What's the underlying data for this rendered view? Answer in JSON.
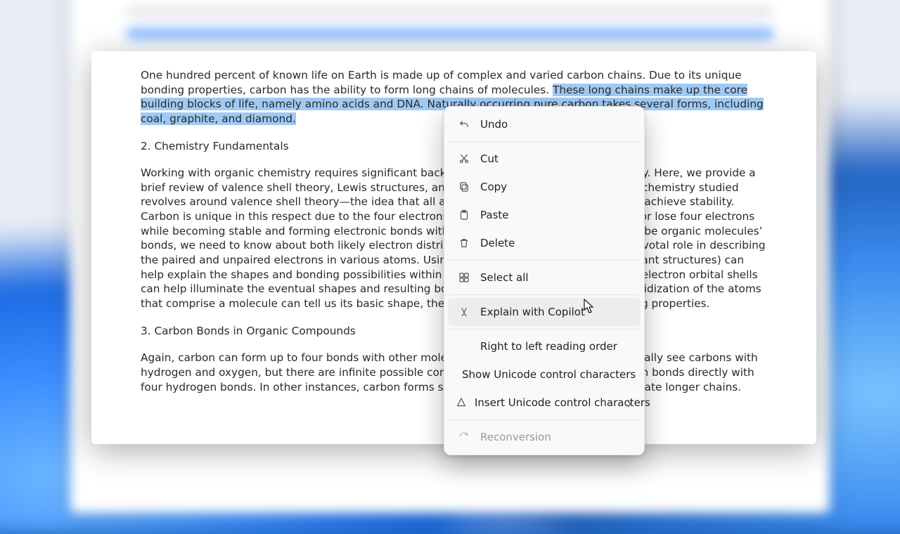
{
  "document": {
    "para1": {
      "before": "One hundred percent of known life on Earth is made up of complex and varied carbon chains. Due to its unique bonding properties, carbon has the ability to form long chains of molecules. ",
      "selected": "These long chains make up the core building blocks of life, namely amino acids and DNA. Naturally occurring pure carbon takes several forms, including coal, graphite, and diamond."
    },
    "heading2": "2. Chemistry Fundamentals",
    "para2": "Working with organic chemistry requires significant background in classic analytical chemistry. Here, we provide a brief review of valence shell theory, Lewis structures, and molecular geometry. Most organic chemistry studied revolves around valence shell theory—the idea that all atoms either gain or lose electrons to achieve stability. Carbon is unique in this respect due to the four electrons in its outer shell. It can either gain or lose four electrons while becoming stable and forming electronic bonds with other atoms or molecules. To describe organic molecules’ bonds, we need to know about both likely electron distribution. Lewis dot structures play a pivotal role in describing the paired and unpaired electrons in various atoms. Using these structures (examining resonant structures) can help explain the shapes and bonding possibilities within organic compounds. Knowing about electron orbital shells can help illuminate the eventual shapes and resulting bonds in organic compounds. The hybridization of the atoms that comprise a molecule can tell us its basic shape, the angle of its bonds, and its underlying properties.",
    "heading3": "3. Carbon Bonds in Organic Compounds",
    "para3": "Again, carbon can form up to four bonds with other molecules. In organic chemistry, we typically see carbons with hydrogen and oxygen, but there are infinite possible compounds. In the simplest form, carbon bonds directly with four hydrogen bonds. In other instances, carbon forms single bonds with other carbons to create longer chains."
  },
  "context_menu": {
    "undo": {
      "label": "Undo"
    },
    "cut": {
      "label": "Cut"
    },
    "copy": {
      "label": "Copy"
    },
    "paste": {
      "label": "Paste"
    },
    "delete": {
      "label": "Delete"
    },
    "selectall": {
      "label": "Select all"
    },
    "explain": {
      "label": "Explain with Copilot"
    },
    "rtl": {
      "label": "Right to left reading order"
    },
    "showuni": {
      "label": "Show Unicode control characters"
    },
    "insuni": {
      "label": "Insert Unicode control characters"
    },
    "reconv": {
      "label": "Reconversion"
    }
  }
}
